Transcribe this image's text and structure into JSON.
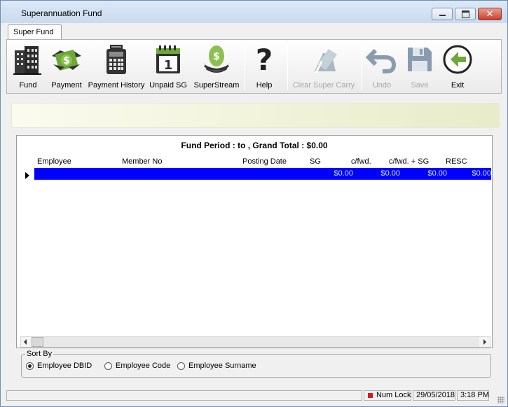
{
  "window": {
    "title": "Superannuation Fund",
    "close_glyph": "✕"
  },
  "ribbon": {
    "tab_label": "Super Fund"
  },
  "toolbar": {
    "buttons": [
      {
        "label": "Fund",
        "icon": "building-icon",
        "enabled": true
      },
      {
        "label": "Payment",
        "icon": "money-handshake-icon",
        "enabled": true
      },
      {
        "label": "Payment History",
        "icon": "calculator-icon",
        "enabled": true
      },
      {
        "label": "Unpaid SG",
        "icon": "calendar-icon",
        "enabled": true
      },
      {
        "label": "SuperStream",
        "icon": "nest-egg-icon",
        "enabled": true
      },
      {
        "label": "Help",
        "icon": "help-question-icon",
        "enabled": true
      },
      {
        "label": "Clear Super Carry",
        "icon": "eraser-icon",
        "enabled": false
      },
      {
        "label": "Undo",
        "icon": "undo-arrow-icon",
        "enabled": false
      },
      {
        "label": "Save",
        "icon": "floppy-disk-icon",
        "enabled": false
      },
      {
        "label": "Exit",
        "icon": "exit-arrow-icon",
        "enabled": true
      }
    ]
  },
  "grid": {
    "fund_header": "Fund Period :  to ,  Grand Total : $0.00",
    "columns": [
      "Employee",
      "Member No",
      "Posting Date",
      "SG",
      "c/fwd.",
      "c/fwd. + SG",
      "RESC"
    ],
    "rows": [
      {
        "employee": "",
        "member_no": "",
        "posting_date": "",
        "sg": "$0.00",
        "cfwd": "$0.00",
        "cfwd_sg": "$0.00",
        "resc": "$0.00"
      }
    ]
  },
  "sort_by": {
    "legend": "Sort By",
    "options": [
      {
        "label": "Employee DBID",
        "selected": true
      },
      {
        "label": "Employee Code",
        "selected": false
      },
      {
        "label": "Employee Surname",
        "selected": false
      }
    ]
  },
  "status_bar": {
    "message": "",
    "num_lock": "Num Lock",
    "date": "29/05/2018",
    "time": "3:18 PM"
  },
  "colors": {
    "selected_row": "#0000ff",
    "selected_row_text": "#cfe9ff",
    "disabled_label": "#a8a8a8",
    "num_lock_indicator": "#e0141e"
  }
}
